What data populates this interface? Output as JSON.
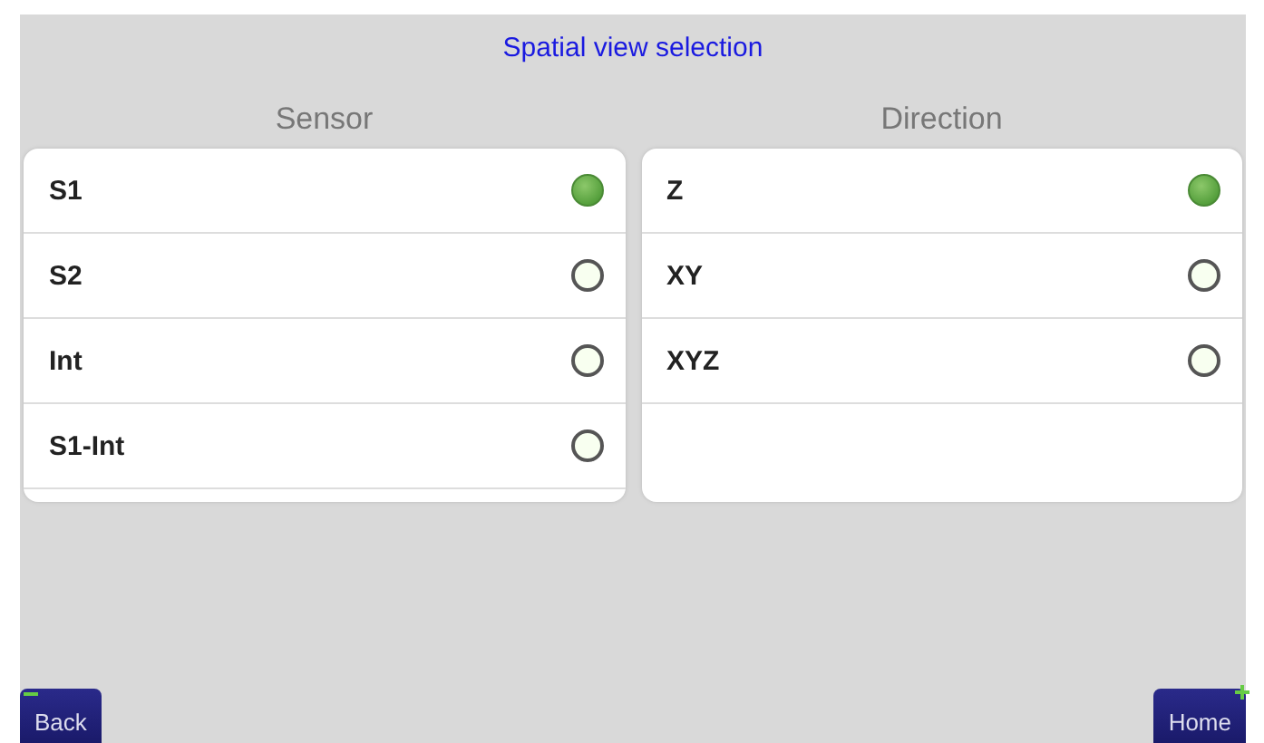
{
  "title": "Spatial view selection",
  "columns": [
    {
      "heading": "Sensor",
      "options": [
        {
          "label": "S1",
          "selected": true
        },
        {
          "label": "S2",
          "selected": false
        },
        {
          "label": "Int",
          "selected": false
        },
        {
          "label": "S1-Int",
          "selected": false
        }
      ]
    },
    {
      "heading": "Direction",
      "options": [
        {
          "label": "Z",
          "selected": true
        },
        {
          "label": "XY",
          "selected": false
        },
        {
          "label": "XYZ",
          "selected": false
        }
      ]
    }
  ],
  "buttons": [
    {
      "label": "Back",
      "kind": "back"
    },
    {
      "label": "Home",
      "kind": "home"
    }
  ]
}
